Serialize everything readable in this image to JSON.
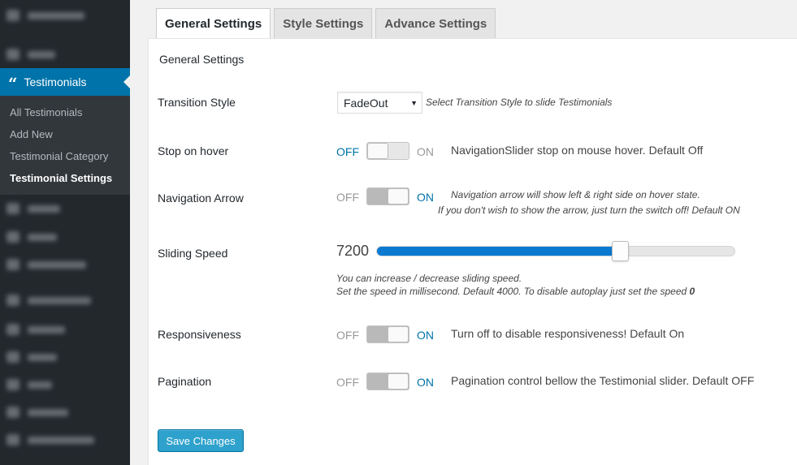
{
  "sidebar": {
    "active_menu": {
      "icon": "quote-icon",
      "label": "Testimonials"
    },
    "submenu": [
      {
        "label": "All Testimonials"
      },
      {
        "label": "Add New"
      },
      {
        "label": "Testimonial Category"
      },
      {
        "label": "Testimonial Settings",
        "current": true
      }
    ]
  },
  "tabs": [
    {
      "label": "General Settings",
      "active": true
    },
    {
      "label": "Style Settings"
    },
    {
      "label": "Advance Settings"
    }
  ],
  "panel": {
    "title": "General Settings",
    "transition": {
      "label": "Transition Style",
      "selected": "FadeOut",
      "hint": "Select Transition Style to slide Testimonials"
    },
    "stop_on_hover": {
      "label": "Stop on hover",
      "off": "OFF",
      "on": "ON",
      "state": "off",
      "hint": "NavigationSlider stop on mouse hover. Default Off"
    },
    "navigation_arrow": {
      "label": "Navigation Arrow",
      "off": "OFF",
      "on": "ON",
      "state": "on",
      "hint_line1": "Navigation arrow will show left & right side on hover state.",
      "hint_line2": "If you don't wish to show the arrow, just turn the switch off! Default ON"
    },
    "sliding_speed": {
      "label": "Sliding Speed",
      "value": "7200",
      "fill_fraction": 0.68,
      "hint_line1": "You can increase / decrease sliding speed.",
      "hint_line2": "Set the speed in millisecond. Default 4000. To disable autoplay just set the speed ",
      "hint_bold": "0"
    },
    "responsiveness": {
      "label": "Responsiveness",
      "off": "OFF",
      "on": "ON",
      "state": "on",
      "hint": "Turn off to disable responsiveness! Default On"
    },
    "pagination": {
      "label": "Pagination",
      "off": "OFF",
      "on": "ON",
      "state": "on",
      "hint": "Pagination control bellow the Testimonial slider. Default OFF"
    },
    "save_label": "Save Changes"
  },
  "colors": {
    "accent": "#0073aa",
    "active_toggle_text": "#0073aa",
    "inactive_toggle_text": "#999999",
    "button": "#2ea2cc"
  }
}
